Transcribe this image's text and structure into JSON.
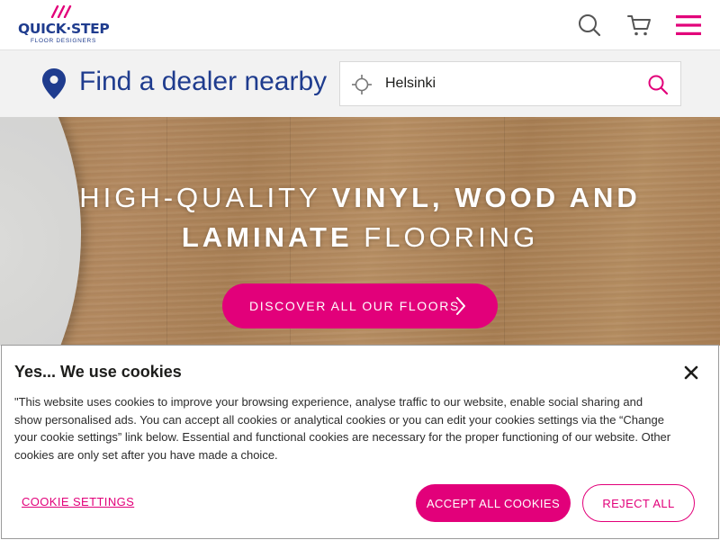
{
  "header": {
    "logo": {
      "wordmark": "QUICK·STEP",
      "tagline": "FLOOR DESIGNERS"
    },
    "icons": [
      "search-icon",
      "cart-icon",
      "hamburger-menu-icon"
    ],
    "accent_color": "#e2007a",
    "brand_color": "#1f3c8e"
  },
  "dealer": {
    "title": "Find a dealer nearby",
    "search_value": "Helsinki",
    "icons": [
      "location-pin-icon",
      "locate-crosshair-icon",
      "search-icon"
    ]
  },
  "hero": {
    "line1_thin": "HIGH-QUALITY ",
    "line1_bold": "VINYL, WOOD AND",
    "line2_bold": "LAMINATE",
    "line2_thin": " FLOORING",
    "cta_label": "DISCOVER ALL OUR FLOORS"
  },
  "cookie": {
    "title": "Yes... We use cookies",
    "body": "\"This website uses cookies to improve your browsing experience, analyse traffic to our website, enable social sharing and show personalised ads. You can accept all cookies or analytical cookies or you can edit your cookies settings via the “Change your cookie settings” link below. Essential and functional cookies are necessary for the proper functioning of our website. Other cookies are only set after you have made a choice.",
    "settings_link": "COOKIE SETTINGS",
    "accept_label": "ACCEPT ALL COOKIES",
    "reject_label": "REJECT ALL"
  }
}
